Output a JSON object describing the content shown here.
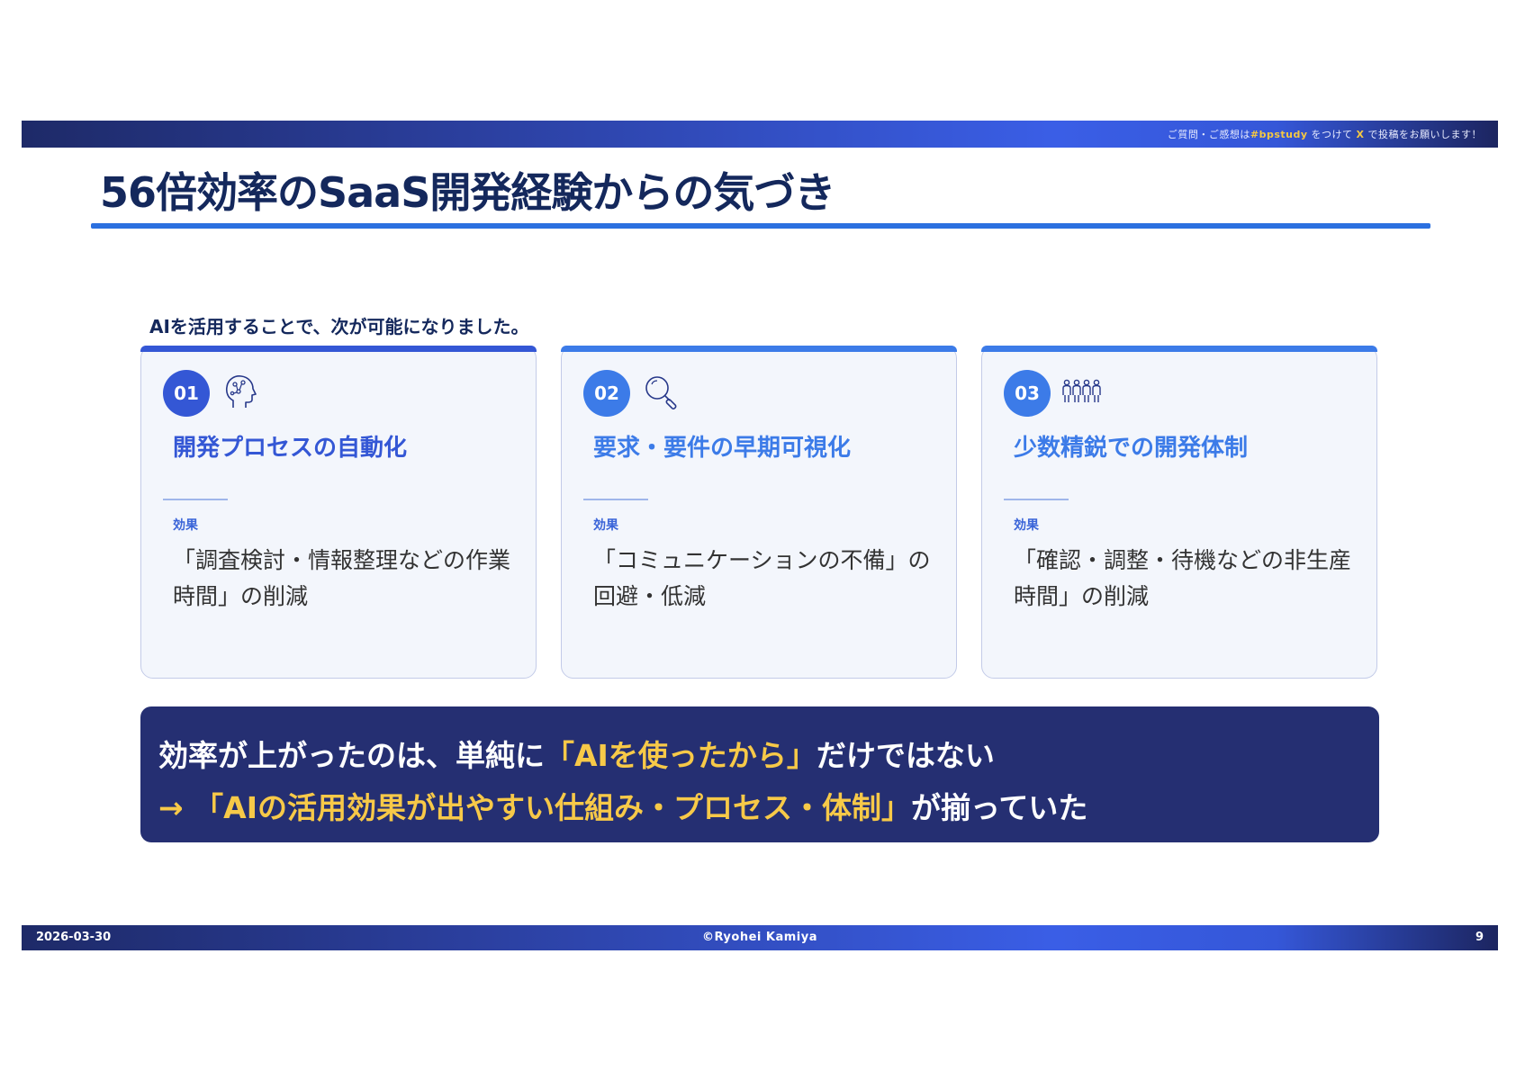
{
  "header": {
    "note_pre": "ご質問・ご感想は",
    "note_hashtag": "#bpstudy",
    "note_mid": "をつけて",
    "note_x": "X",
    "note_post": "で投稿をお願いします！"
  },
  "title": "56倍効率のSaaS開発経験からの気づき",
  "lead": "AIを活用することで、次が可能になりました。",
  "cards": [
    {
      "number": "01",
      "icon": "ai-brain-icon",
      "title": "開発プロセスの自動化",
      "effect_label": "効果",
      "effect_text": "「調査検討・情報整理などの作業時間」の削減",
      "accent_color": "#3457d5"
    },
    {
      "number": "02",
      "icon": "magnifier-icon",
      "title": "要求・要件の早期可視化",
      "effect_label": "効果",
      "effect_text": "「コミュニケーションの不備」の回避・低減",
      "accent_color": "#3c7be8"
    },
    {
      "number": "03",
      "icon": "team-icon",
      "title": "少数精鋭での開発体制",
      "effect_label": "効果",
      "effect_text": "「確認・調整・待機などの非生産時間」の削減",
      "accent_color": "#3c7be8"
    }
  ],
  "summary": {
    "line1_pre": "効率が上がったのは、単純に",
    "line1_hl": "「AIを使ったから」",
    "line1_post": "だけではない",
    "line2_arrow": "→",
    "line2_hl": "「AIの活用効果が出やすい仕組み・プロセス・体制」",
    "line2_post": "が揃っていた"
  },
  "footer": {
    "date": "2026-03-30",
    "copyright": "©Ryohei Kamiya",
    "page": "9"
  },
  "colors": {
    "title": "#14285c",
    "accent_rule": "#2b70e0",
    "summary_bg": "#252f72",
    "highlight": "#f7c948"
  }
}
